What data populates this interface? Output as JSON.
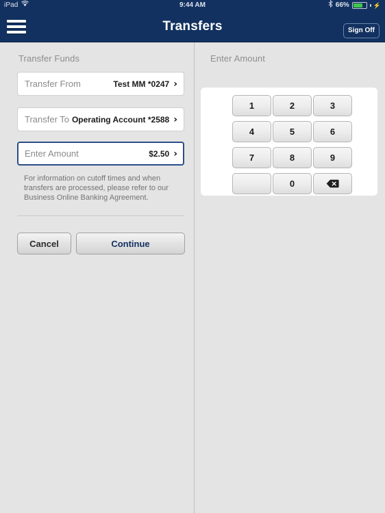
{
  "statusbar": {
    "device": "iPad",
    "wifi_icon": "wifi-icon",
    "time": "9:44 AM",
    "bluetooth_icon": "bluetooth-icon",
    "battery_percent": "66%",
    "battery_level": 66,
    "charging_icon": "lightning-bolt-icon"
  },
  "navbar": {
    "menu_icon": "hamburger-menu-icon",
    "title": "Transfers",
    "signoff_label": "Sign Off"
  },
  "left_panel": {
    "section_label": "Transfer Funds",
    "rows": [
      {
        "label": "Transfer From",
        "value": "Test MM *0247",
        "chevron": "›",
        "active": false
      },
      {
        "label": "Transfer To",
        "value": "Operating Account *2588",
        "chevron": "›",
        "active": false
      },
      {
        "label": "Enter Amount",
        "value": "$2.50",
        "chevron": "›",
        "active": true
      }
    ],
    "disclaimer": "For information on cutoff times and when transfers are processed, please refer to our Business Online Banking Agreement.",
    "cancel_label": "Cancel",
    "continue_label": "Continue"
  },
  "right_panel": {
    "section_label": "Enter Amount",
    "keypad": {
      "keys": [
        "1",
        "2",
        "3",
        "4",
        "5",
        "6",
        "7",
        "8",
        "9",
        "",
        "0",
        "delete"
      ],
      "delete_icon": "backspace-delete-icon"
    }
  },
  "colors": {
    "navy": "#123160",
    "page_background": "#e4e4e4",
    "card_white": "#ffffff",
    "active_border": "#2a4d86",
    "battery_green": "#41c64a",
    "label_gray": "#8a8a8a"
  }
}
